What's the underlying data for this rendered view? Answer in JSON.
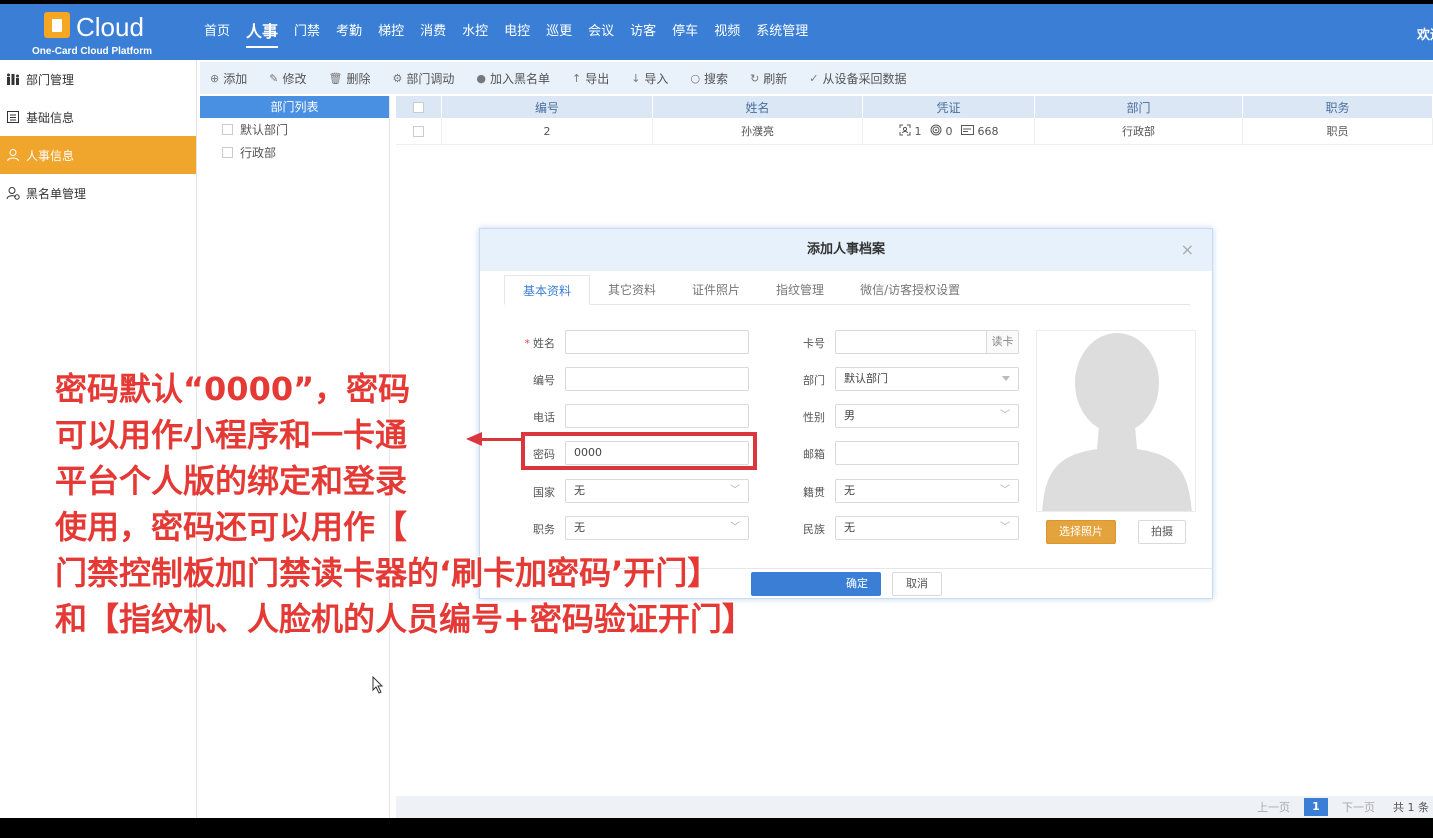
{
  "header": {
    "logo_text": "Cloud",
    "logo_sub": "One-Card Cloud Platform",
    "nav": [
      "首页",
      "人事",
      "门禁",
      "考勤",
      "梯控",
      "消费",
      "水控",
      "电控",
      "巡更",
      "会议",
      "访客",
      "停车",
      "视频",
      "系统管理"
    ],
    "active_nav": "人事",
    "welcome": "欢迎"
  },
  "sidebar": {
    "items": [
      {
        "label": "部门管理",
        "icon": "org-chart-icon"
      },
      {
        "label": "基础信息",
        "icon": "list-icon"
      },
      {
        "label": "人事信息",
        "icon": "person-icon"
      },
      {
        "label": "黑名单管理",
        "icon": "person-block-icon"
      }
    ],
    "active_index": 2
  },
  "toolbar": {
    "buttons": [
      {
        "label": "添加",
        "icon": "⊕"
      },
      {
        "label": "修改",
        "icon": "✎"
      },
      {
        "label": "删除",
        "icon": "🗑"
      },
      {
        "label": "部门调动",
        "icon": "⚙"
      },
      {
        "label": "加入黑名单",
        "icon": "●"
      },
      {
        "label": "导出",
        "icon": "↑"
      },
      {
        "label": "导入",
        "icon": "↓"
      },
      {
        "label": "搜索",
        "icon": "○"
      },
      {
        "label": "刷新",
        "icon": "↻"
      },
      {
        "label": "从设备采回数据",
        "icon": "✓"
      }
    ]
  },
  "dept_panel": {
    "title": "部门列表",
    "nodes": [
      "默认部门",
      "行政部"
    ]
  },
  "table": {
    "columns": [
      "编号",
      "姓名",
      "凭证",
      "部门",
      "职务"
    ],
    "rows": [
      {
        "id": "2",
        "name": "孙濮亮",
        "face": "1",
        "finger": "0",
        "card": "668",
        "dept": "行政部",
        "position": "职员"
      }
    ]
  },
  "pager": {
    "prev": "上一页",
    "current": "1",
    "next": "下一页",
    "total": "共 1 条"
  },
  "modal": {
    "title": "添加人事档案",
    "close": "×",
    "tabs": [
      "基本资料",
      "其它资料",
      "证件照片",
      "指纹管理",
      "微信/访客授权设置"
    ],
    "fields": {
      "name_label": "姓名",
      "number_label": "编号",
      "phone_label": "电话",
      "password_label": "密码",
      "password_value": "0000",
      "country_label": "国家",
      "country_value": "无",
      "duty_label": "职务",
      "duty_value": "无",
      "card_label": "卡号",
      "read_card": "读卡",
      "dept_label": "部门",
      "dept_value": "默认部门",
      "gender_label": "性别",
      "gender_value": "男",
      "email_label": "邮箱",
      "native_label": "籍贯",
      "native_value": "无",
      "ethnic_label": "民族",
      "ethnic_value": "无"
    },
    "choose_photo": "选择照片",
    "take_photo": "拍摄",
    "ok": "确定",
    "cancel": "取消"
  },
  "annotation": {
    "text": "密码默认“0000”，密码\n可以用作小程序和一卡通\n平台个人版的绑定和登录\n使用，密码还可以用作【\n门禁控制板加门禁读卡器的‘刷卡加密码’开门】\n和【指纹机、人脸机的人员编号+密码验证开门】"
  },
  "colors": {
    "header_bg": "#3a7fd5",
    "sidebar_active": "#f0a52c",
    "annotation_red": "#e53935",
    "highlight_box": "#d9363e"
  }
}
